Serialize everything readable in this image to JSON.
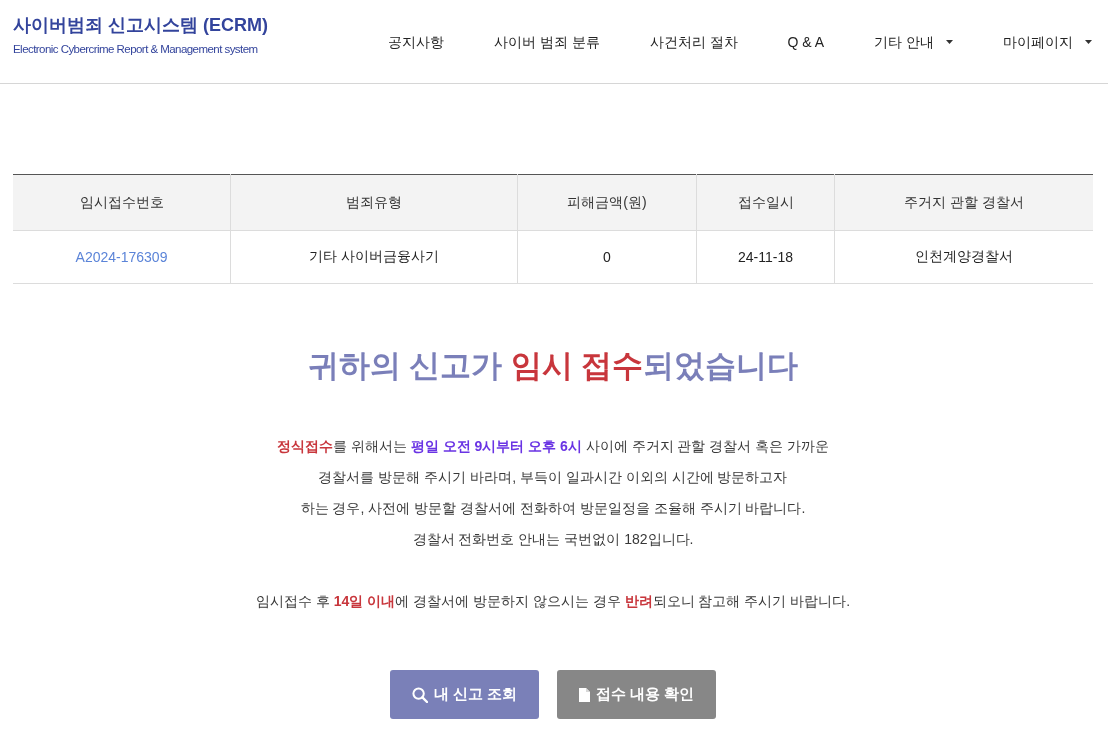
{
  "header": {
    "title": "사이버범죄 신고시스템 (ECRM)",
    "subtitle": "Electronic Cybercrime Report & Management system",
    "nav": [
      {
        "label": "공지사항",
        "dropdown": false
      },
      {
        "label": "사이버 범죄 분류",
        "dropdown": false
      },
      {
        "label": "사건처리 절차",
        "dropdown": false
      },
      {
        "label": "Q & A",
        "dropdown": false
      },
      {
        "label": "기타 안내",
        "dropdown": true
      },
      {
        "label": "마이페이지",
        "dropdown": true
      }
    ]
  },
  "table": {
    "columns": [
      "임시접수번호",
      "범죄유형",
      "피해금액(원)",
      "접수일시",
      "주거지 관할 경찰서"
    ],
    "rows": [
      {
        "cells": [
          {
            "text": "A2024-176309",
            "kind": "link"
          },
          {
            "text": "기타 사이버금융사기",
            "kind": "text"
          },
          {
            "text": "0",
            "kind": "text"
          },
          {
            "text": "24-11-18",
            "kind": "text"
          },
          {
            "text": "인천계양경찰서",
            "kind": "text"
          }
        ]
      }
    ]
  },
  "message": {
    "title": [
      {
        "text": "귀하의 신고가 ",
        "kind": "plain"
      },
      {
        "text": "임시 접수",
        "kind": "alert"
      },
      {
        "text": "되었습니다",
        "kind": "plain"
      }
    ],
    "notice_lines": [
      [
        {
          "text": "정식접수",
          "kind": "alert"
        },
        {
          "text": "를 위해서는 ",
          "kind": "plain"
        },
        {
          "text": "평일 오전 9시부터 오후 6시",
          "kind": "schedule"
        },
        {
          "text": " 사이에 주거지 관할 경찰서 혹은 가까운",
          "kind": "plain"
        }
      ],
      [
        {
          "text": "경찰서를 방문해 주시기 바라며, 부득이 일과시간 이외의 시간에 방문하고자",
          "kind": "plain"
        }
      ],
      [
        {
          "text": "하는 경우, 사전에 방문할 경찰서에 전화하여 방문일정을 조율해 주시기 바랍니다.",
          "kind": "plain"
        }
      ],
      [
        {
          "text": "경찰서 전화번호 안내는 국번없이 182입니다.",
          "kind": "plain"
        }
      ]
    ],
    "warning": [
      {
        "text": "임시접수 후 ",
        "kind": "plain"
      },
      {
        "text": "14일 이내",
        "kind": "alert"
      },
      {
        "text": "에 경찰서에 방문하지 않으시는 경우 ",
        "kind": "plain"
      },
      {
        "text": "반려",
        "kind": "alert"
      },
      {
        "text": "되오니 참고해 주시기 바랍니다.",
        "kind": "plain"
      }
    ]
  },
  "buttons": [
    {
      "label": "내 신고 조회",
      "kind": "primary"
    },
    {
      "label": "접수 내용 확인",
      "kind": "secondary"
    }
  ]
}
